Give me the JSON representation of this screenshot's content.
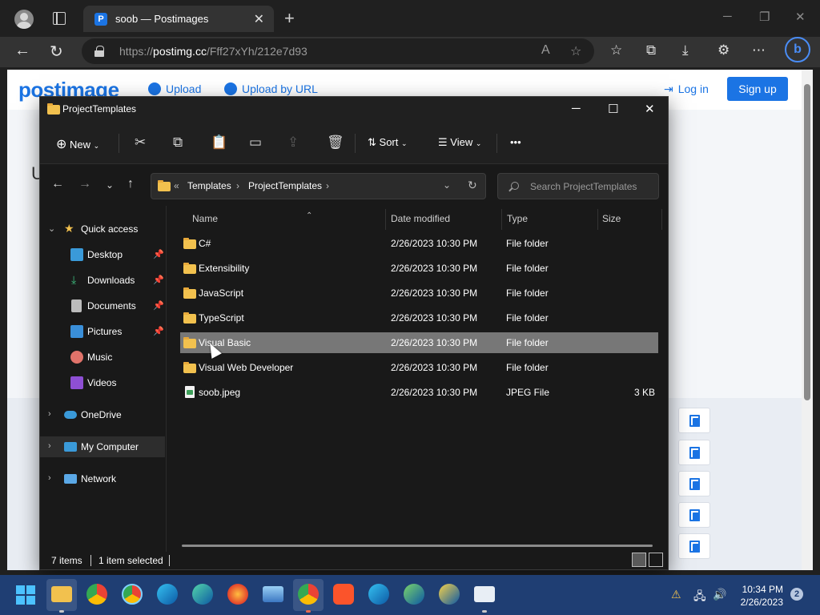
{
  "browser": {
    "tab_title": "soob — Postimages",
    "tab_favicon": "P",
    "url_prefix": "https://",
    "url_host": "postimg.cc",
    "url_path": "/Fff27xYh/212e7d93",
    "icons": [
      "profile-icon",
      "tab-actions-icon",
      "back-icon",
      "refresh-icon",
      "lock-icon",
      "read-aloud-icon",
      "add-favorite-icon",
      "favorites-icon",
      "collections-icon",
      "downloads-icon",
      "extensions-icon",
      "more-icon",
      "bing-chat-icon"
    ]
  },
  "website": {
    "logo": "postimage",
    "upload_label": "Upload",
    "upload_by_url_label": "Upload by URL",
    "login_label": "Log in",
    "signup_label": "Sign up",
    "partial_heading": "U",
    "brand_color": "#1b74e4"
  },
  "explorer": {
    "title": "ProjectTemplates",
    "commands": {
      "new_label": "New",
      "sort_label": "Sort",
      "view_label": "View",
      "more": "•••"
    },
    "breadcrumb": {
      "overflow": "«",
      "items": [
        "Templates",
        "ProjectTemplates"
      ]
    },
    "search_placeholder": "Search ProjectTemplates",
    "nav": {
      "quick_access": "Quick access",
      "pinned": [
        "Desktop",
        "Downloads",
        "Documents",
        "Pictures"
      ],
      "unpinned": [
        "Music",
        "Videos"
      ],
      "onedrive": "OneDrive",
      "my_computer": "My Computer",
      "network": "Network"
    },
    "columns": {
      "name": "Name",
      "date": "Date modified",
      "type": "Type",
      "size": "Size"
    },
    "files": [
      {
        "name": "C#",
        "date": "2/26/2023 10:30 PM",
        "type": "File folder",
        "size": ""
      },
      {
        "name": "Extensibility",
        "date": "2/26/2023 10:30 PM",
        "type": "File folder",
        "size": ""
      },
      {
        "name": "JavaScript",
        "date": "2/26/2023 10:30 PM",
        "type": "File folder",
        "size": ""
      },
      {
        "name": "TypeScript",
        "date": "2/26/2023 10:30 PM",
        "type": "File folder",
        "size": ""
      },
      {
        "name": "Visual Basic",
        "date": "2/26/2023 10:30 PM",
        "type": "File folder",
        "size": "",
        "selected": true
      },
      {
        "name": "Visual Web Developer",
        "date": "2/26/2023 10:30 PM",
        "type": "File folder",
        "size": ""
      },
      {
        "name": "soob.jpeg",
        "date": "2/26/2023 10:30 PM",
        "type": "JPEG File",
        "size": "3 KB"
      }
    ],
    "status": {
      "count": "7 items",
      "selected": "1 item selected"
    }
  },
  "taskbar": {
    "apps": [
      "file-explorer",
      "chrome",
      "chrome-canary-color",
      "edge",
      "edge-alt",
      "firefox",
      "photos",
      "chrome-active",
      "brave",
      "edge-beta",
      "edge-dev",
      "edge-canary",
      "notepad"
    ],
    "time": "10:34 PM",
    "date": "2/26/2023",
    "notifications": "2",
    "accent": "#1f3e73"
  }
}
